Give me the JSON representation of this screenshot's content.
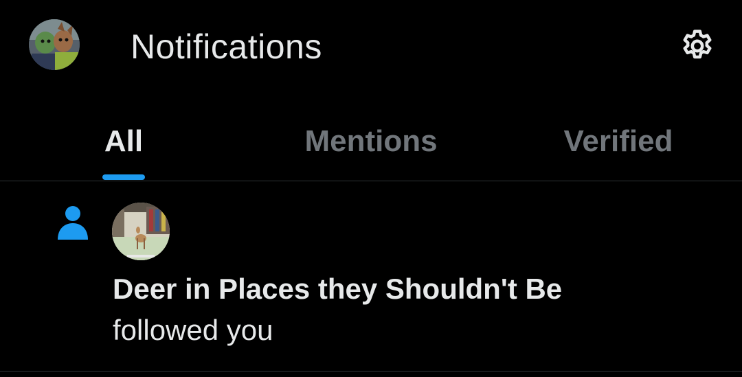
{
  "header": {
    "title": "Notifications",
    "avatar_icon": "profile-avatar",
    "settings_icon": "gear-icon"
  },
  "tabs": [
    {
      "label": "All",
      "active": true
    },
    {
      "label": "Mentions",
      "active": false
    },
    {
      "label": "Verified",
      "active": false
    }
  ],
  "notifications": [
    {
      "type_icon": "person-icon",
      "name": "Deer in Places they Shouldn't Be",
      "action": "followed you"
    }
  ],
  "colors": {
    "background": "#000000",
    "primary_text": "#e7e9ea",
    "secondary_text": "#71767b",
    "accent": "#1d9bf0",
    "divider": "#2f3336"
  }
}
